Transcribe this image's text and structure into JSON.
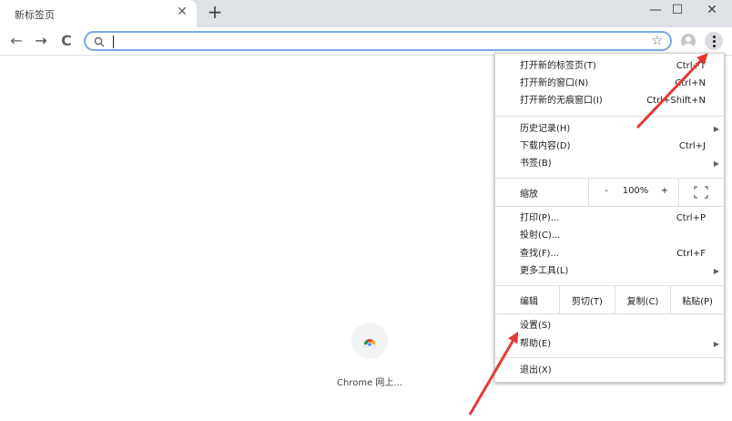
{
  "tab": {
    "title": "新标签页",
    "close": "✕",
    "new_tab": "+"
  },
  "window_controls": {
    "minimize": "—",
    "maximize": "☐",
    "close": "✕"
  },
  "toolbar": {
    "back": "←",
    "forward": "→",
    "reload": "C",
    "omnibox_value": "",
    "bookmark_star": "☆"
  },
  "ntp": {
    "tile_label": "Chrome 网上..."
  },
  "menu": {
    "group1": [
      {
        "label": "打开新的标签页(T)",
        "shortcut": "Ctrl+T"
      },
      {
        "label": "打开新的窗口(N)",
        "shortcut": "Ctrl+N"
      },
      {
        "label": "打开新的无痕窗口(I)",
        "shortcut": "Ctrl+Shift+N"
      }
    ],
    "group2": [
      {
        "label": "历史记录(H)",
        "shortcut": ""
      },
      {
        "label": "下载内容(D)",
        "shortcut": "Ctrl+J"
      },
      {
        "label": "书签(B)",
        "shortcut": ""
      }
    ],
    "zoom": {
      "label": "缩放",
      "minus": "-",
      "value": "100%",
      "plus": "+"
    },
    "group3": [
      {
        "label": "打印(P)...",
        "shortcut": "Ctrl+P"
      },
      {
        "label": "投射(C)...",
        "shortcut": ""
      },
      {
        "label": "查找(F)...",
        "shortcut": "Ctrl+F"
      },
      {
        "label": "更多工具(L)",
        "shortcut": ""
      }
    ],
    "edit": {
      "label": "编辑",
      "cut": "剪切(T)",
      "copy": "复制(C)",
      "paste": "粘贴(P)"
    },
    "settings": "设置(S)",
    "help": "帮助(E)",
    "exit": "退出(X)",
    "submenu_arrow": "▶"
  },
  "colors": {
    "annotation_arrow": "#e53935",
    "omnibox_border": "#7aa7e6"
  }
}
